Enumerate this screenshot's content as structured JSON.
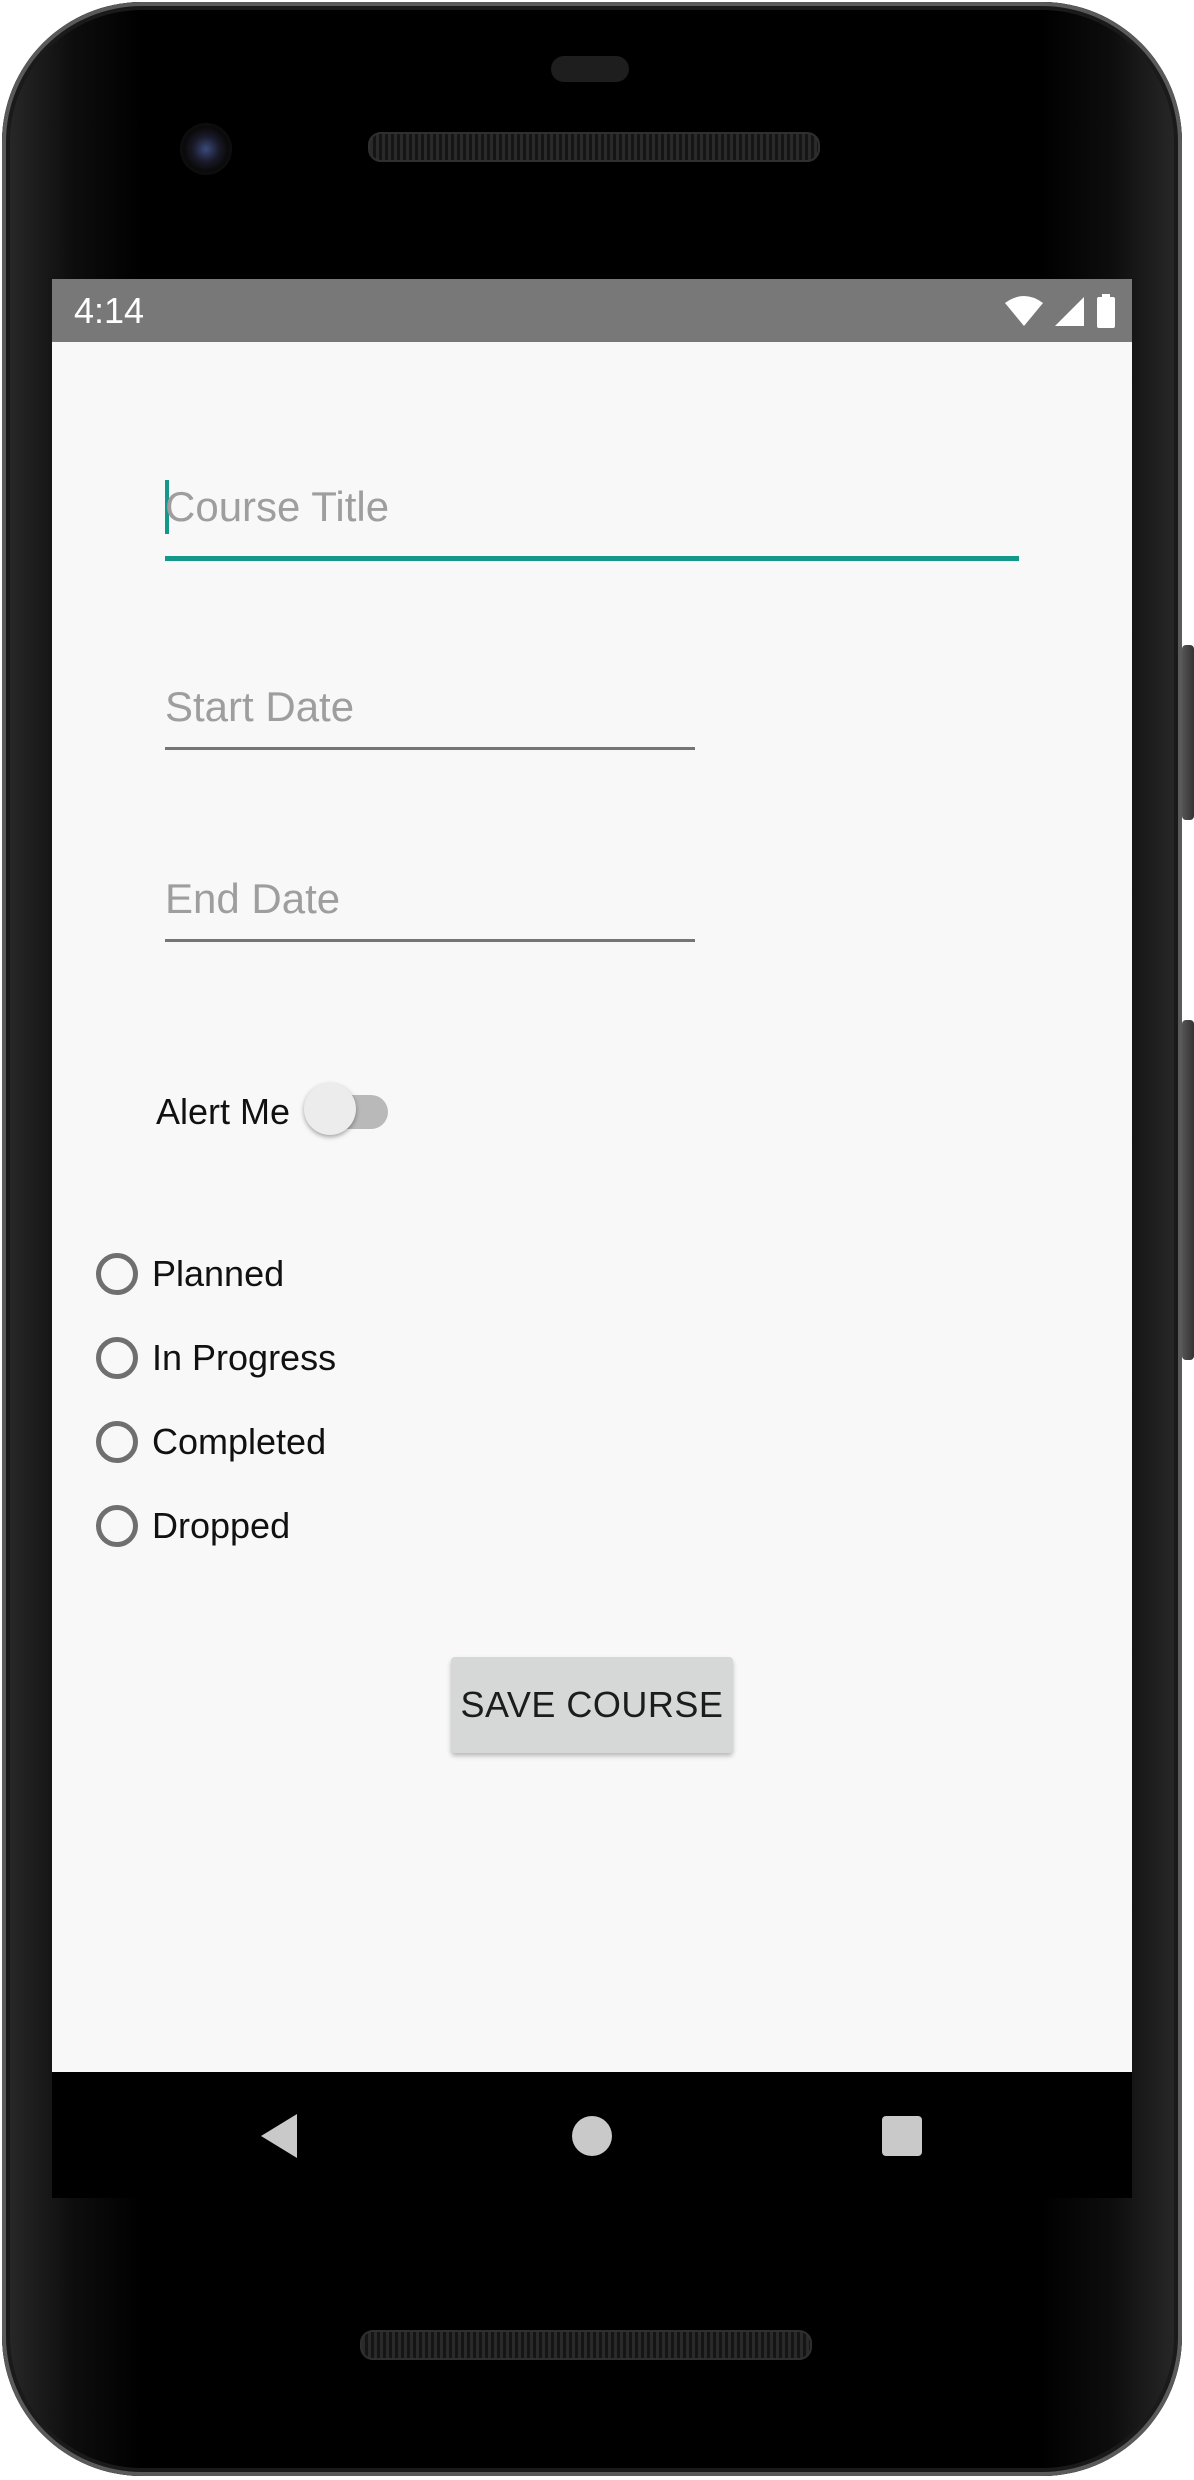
{
  "status_bar": {
    "time": "4:14",
    "icons": [
      "wifi-icon",
      "cellular-signal-icon",
      "battery-icon"
    ]
  },
  "form": {
    "course_title": {
      "placeholder": "Course Title",
      "value": ""
    },
    "start_date": {
      "placeholder": "Start Date",
      "value": ""
    },
    "end_date": {
      "placeholder": "End Date",
      "value": ""
    },
    "alert_label": "Alert Me",
    "alert_enabled": false,
    "status_options": [
      "Planned",
      "In Progress",
      "Completed",
      "Dropped"
    ],
    "selected_status": null,
    "save_label": "SAVE COURSE"
  },
  "navigation": {
    "buttons": [
      "back-icon",
      "home-icon",
      "recents-icon"
    ]
  },
  "colors": {
    "accent": "#14988a",
    "status_bar": "#787878",
    "background": "#f8f8f8",
    "button": "#d6d7d7"
  }
}
